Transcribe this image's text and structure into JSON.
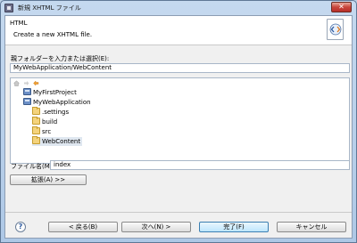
{
  "window": {
    "title": "新規 XHTML ファイル"
  },
  "banner": {
    "title": "HTML",
    "message": "Create a new XHTML file."
  },
  "parent_folder": {
    "label": "親フォルダーを入力または選択(E):",
    "value": "MyWebApplication/WebContent"
  },
  "tree": {
    "items": [
      {
        "label": "MyFirstProject",
        "icon": "project-icon",
        "level": 0
      },
      {
        "label": "MyWebApplication",
        "icon": "project-icon",
        "level": 0
      },
      {
        "label": ".settings",
        "icon": "folder-icon",
        "level": 1
      },
      {
        "label": "build",
        "icon": "folder-icon",
        "level": 1
      },
      {
        "label": "src",
        "icon": "folder-icon",
        "level": 1
      },
      {
        "label": "WebContent",
        "icon": "folder-icon",
        "level": 1,
        "selected": true
      }
    ]
  },
  "file_name": {
    "label": "ファイル名(M):",
    "value": "index"
  },
  "buttons": {
    "advanced": "拡張(A) >>",
    "back": "< 戻る(B)",
    "next": "次へ(N) >",
    "finish": "完了(F)",
    "cancel": "キャンセル"
  },
  "colors": {
    "accent": "#3c7fb1",
    "selection": "#dfe7f0"
  }
}
